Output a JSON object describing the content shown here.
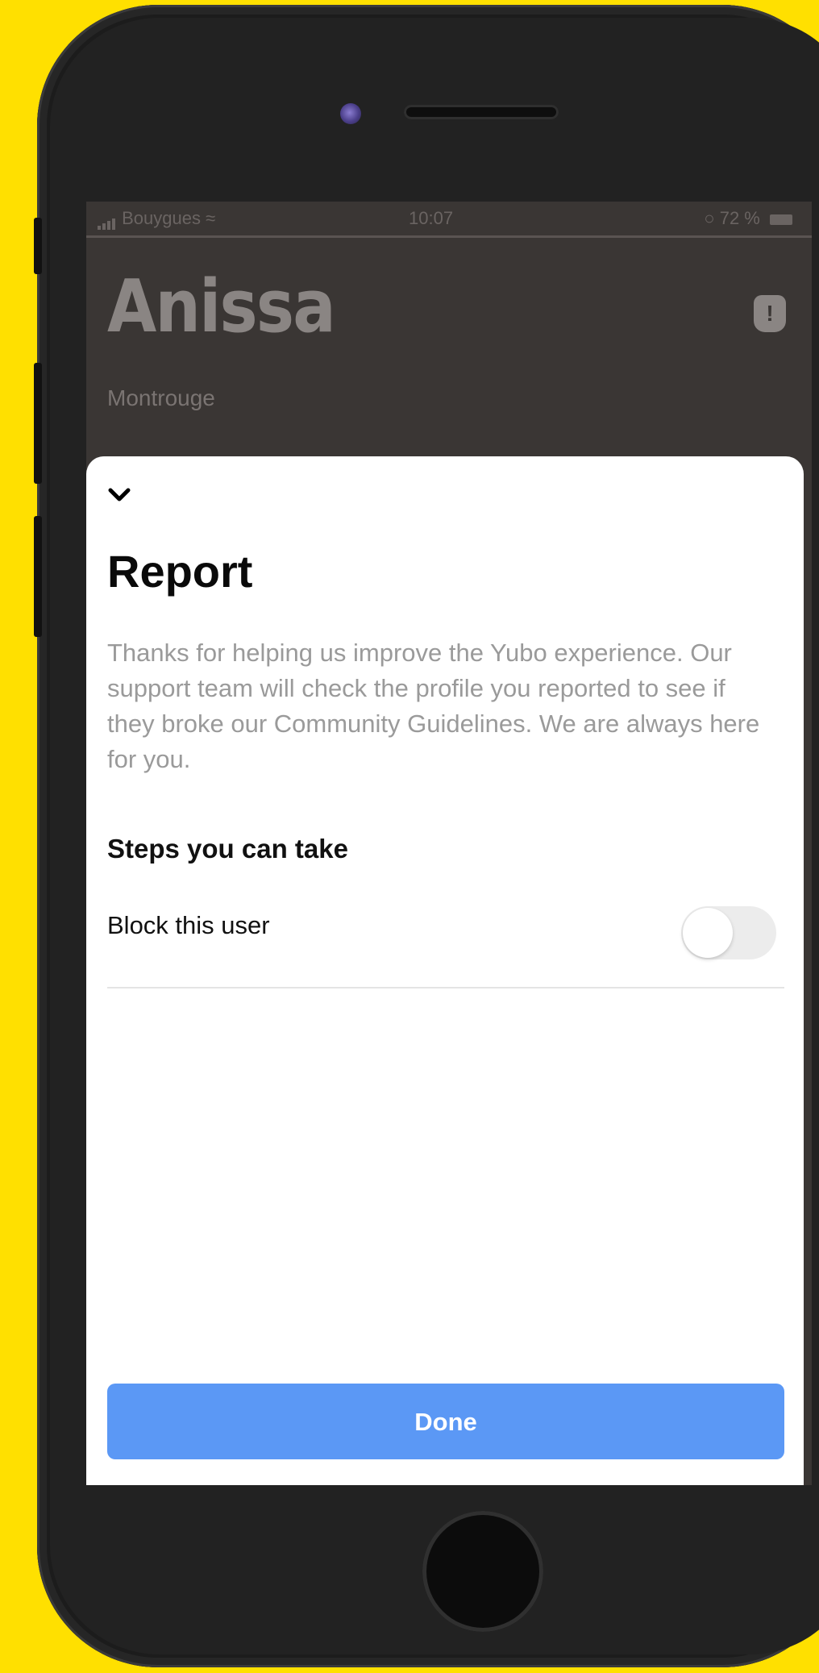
{
  "status_bar": {
    "carrier": "Bouygues",
    "time": "10:07",
    "battery": "72 %"
  },
  "profile": {
    "name": "Anissa",
    "location": "Montrouge"
  },
  "report_sheet": {
    "title": "Report",
    "description": "Thanks for helping us improve the Yubo experience. Our support team will check the profile you reported to see if they broke our Community Guidelines. We are always here for you.",
    "steps_heading": "Steps you can take",
    "block_label": "Block this user",
    "block_enabled": false,
    "done_label": "Done"
  },
  "colors": {
    "background": "#FFE000",
    "primary_button": "#5b98f5"
  }
}
